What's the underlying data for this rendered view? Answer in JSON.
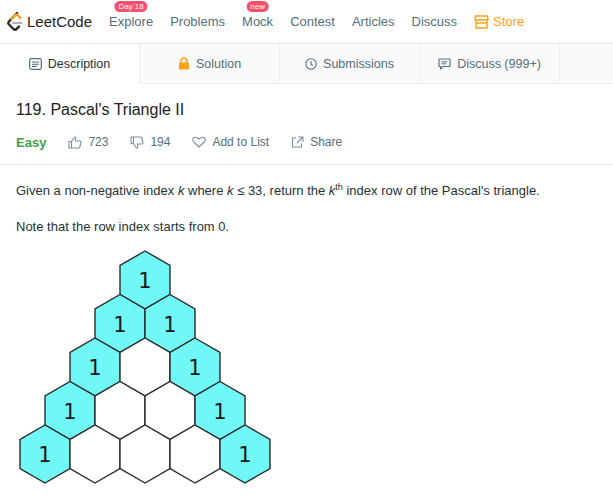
{
  "logo": {
    "text": "LeetCode"
  },
  "nav": [
    {
      "label": "Explore",
      "badge": "Day 18",
      "kind": "link"
    },
    {
      "label": "Problems",
      "badge": "",
      "kind": "link"
    },
    {
      "label": "Mock",
      "badge": "new",
      "kind": "link"
    },
    {
      "label": "Contest",
      "badge": "",
      "kind": "link"
    },
    {
      "label": "Articles",
      "badge": "",
      "kind": "link"
    },
    {
      "label": "Discuss",
      "badge": "",
      "kind": "link"
    },
    {
      "label": "Store",
      "badge": "",
      "kind": "store"
    }
  ],
  "tabs": [
    {
      "label": "Description",
      "selected": true,
      "kind": "description"
    },
    {
      "label": "Solution",
      "selected": false,
      "kind": "solution"
    },
    {
      "label": "Submissions",
      "selected": false,
      "kind": "submissions"
    },
    {
      "label": "Discuss (999+)",
      "selected": false,
      "kind": "discuss"
    }
  ],
  "problem": {
    "title": "119. Pascal's Triangle II",
    "difficulty": "Easy",
    "likes": "723",
    "dislikes": "194",
    "add_to_list": "Add to List",
    "share": "Share"
  },
  "description": {
    "paragraphs": [
      [
        {
          "text": "Given a non-negative index ",
          "kind": "plain"
        },
        {
          "text": "k",
          "kind": "italic"
        },
        {
          "text": " where ",
          "kind": "plain"
        },
        {
          "text": "k",
          "kind": "italic"
        },
        {
          "text": " ≤ 33, return the ",
          "kind": "plain"
        },
        {
          "text": "k",
          "kind": "italic"
        },
        {
          "text": "th",
          "kind": "sup"
        },
        {
          "text": " index row of the Pascal's triangle.",
          "kind": "plain"
        }
      ],
      [
        {
          "text": "Note that the row index starts from 0.",
          "kind": "plain"
        }
      ]
    ]
  },
  "triangle": {
    "rows": [
      [
        {
          "value": "1",
          "filled": true
        }
      ],
      [
        {
          "value": "1",
          "filled": true
        },
        {
          "value": "1",
          "filled": true
        }
      ],
      [
        {
          "value": "1",
          "filled": true
        },
        {
          "value": "",
          "filled": false
        },
        {
          "value": "1",
          "filled": true
        }
      ],
      [
        {
          "value": "1",
          "filled": true
        },
        {
          "value": "",
          "filled": false
        },
        {
          "value": "",
          "filled": false
        },
        {
          "value": "1",
          "filled": true
        }
      ],
      [
        {
          "value": "1",
          "filled": true
        },
        {
          "value": "",
          "filled": false
        },
        {
          "value": "",
          "filled": false
        },
        {
          "value": "",
          "filled": false
        },
        {
          "value": "1",
          "filled": true
        }
      ]
    ]
  }
}
